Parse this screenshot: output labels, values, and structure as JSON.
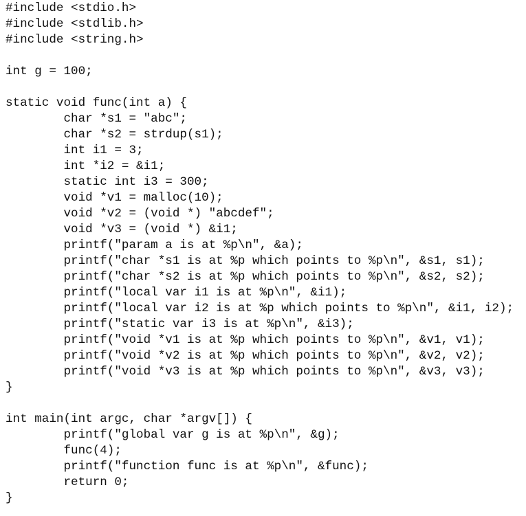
{
  "document": {
    "language": "C",
    "lines": [
      "#include <stdio.h>",
      "#include <stdlib.h>",
      "#include <string.h>",
      "",
      "int g = 100;",
      "",
      "static void func(int a) {",
      "        char *s1 = \"abc\";",
      "        char *s2 = strdup(s1);",
      "        int i1 = 3;",
      "        int *i2 = &i1;",
      "        static int i3 = 300;",
      "        void *v1 = malloc(10);",
      "        void *v2 = (void *) \"abcdef\";",
      "        void *v3 = (void *) &i1;",
      "        printf(\"param a is at %p\\n\", &a);",
      "        printf(\"char *s1 is at %p which points to %p\\n\", &s1, s1);",
      "        printf(\"char *s2 is at %p which points to %p\\n\", &s2, s2);",
      "        printf(\"local var i1 is at %p\\n\", &i1);",
      "        printf(\"local var i2 is at %p which points to %p\\n\", &i1, i2);",
      "        printf(\"static var i3 is at %p\\n\", &i3);",
      "        printf(\"void *v1 is at %p which points to %p\\n\", &v1, v1);",
      "        printf(\"void *v2 is at %p which points to %p\\n\", &v2, v2);",
      "        printf(\"void *v3 is at %p which points to %p\\n\", &v3, v3);",
      "}",
      "",
      "int main(int argc, char *argv[]) {",
      "        printf(\"global var g is at %p\\n\", &g);",
      "        func(4);",
      "        printf(\"function func is at %p\\n\", &func);",
      "        return 0;",
      "}"
    ]
  }
}
